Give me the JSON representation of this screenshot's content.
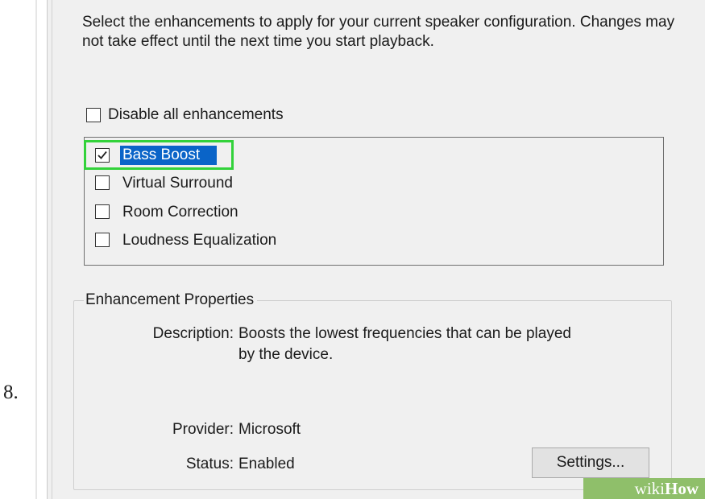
{
  "step_number": "8.",
  "intro_text": "Select the enhancements to apply for your current speaker configuration. Changes may not take effect until the next time you start playback.",
  "disable_all": {
    "label": "Disable all enhancements",
    "checked": false
  },
  "enhancements": [
    {
      "label": "Bass Boost",
      "checked": true,
      "selected": true
    },
    {
      "label": "Virtual Surround",
      "checked": false
    },
    {
      "label": "Room Correction",
      "checked": false
    },
    {
      "label": "Loudness Equalization",
      "checked": false
    }
  ],
  "properties": {
    "group_title": "Enhancement Properties",
    "description_key": "Description:",
    "description_line1": "Boosts the lowest frequencies that can be played",
    "description_line2": "by the device.",
    "provider_key": "Provider:",
    "provider_value": "Microsoft",
    "status_key": "Status:",
    "status_value": "Enabled",
    "settings_button": "Settings..."
  },
  "watermark": {
    "text_a": "wiki",
    "text_b": "How"
  },
  "colors": {
    "dialog_bg": "#f0f0f0",
    "selection": "#0a64c8",
    "highlight": "#32d23a",
    "watermark_bg": "#8fbf6a"
  }
}
